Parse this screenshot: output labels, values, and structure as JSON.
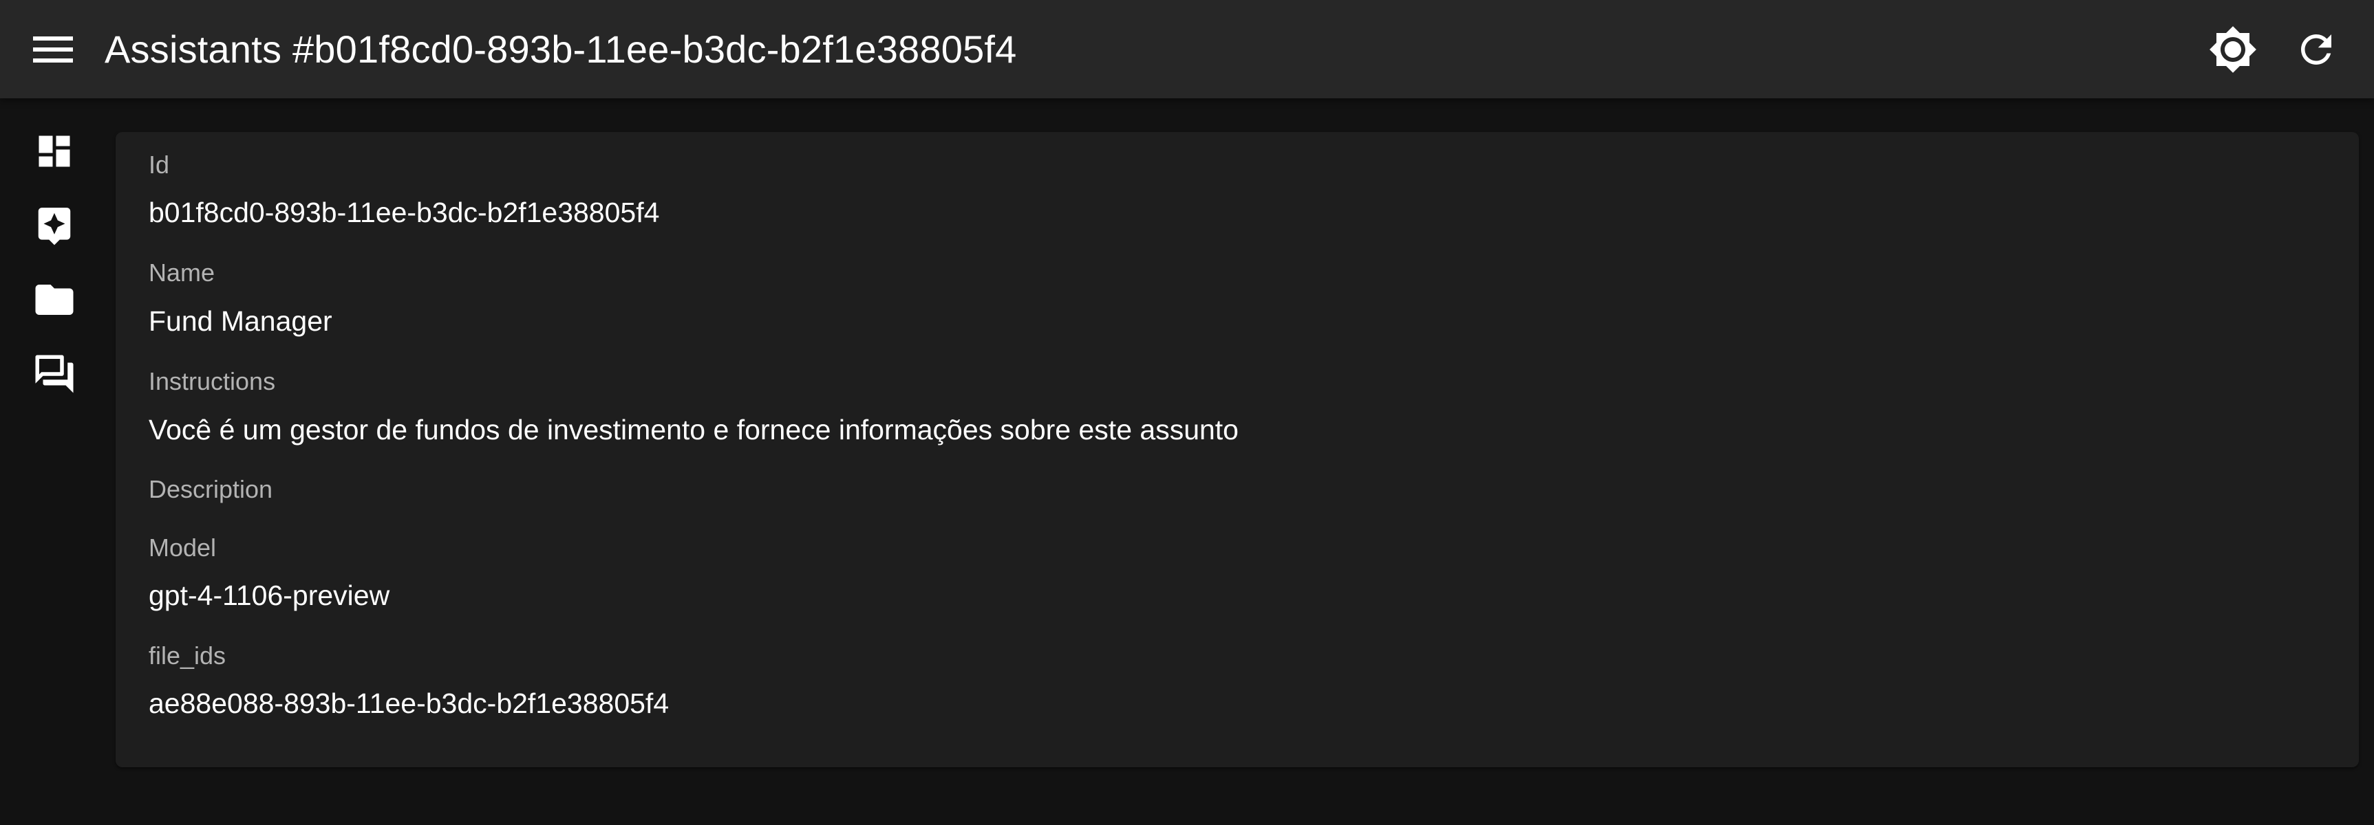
{
  "header": {
    "title": "Assistants #b01f8cd0-893b-11ee-b3dc-b2f1e38805f4",
    "menu_icon": "menu-icon",
    "theme_icon": "brightness-icon",
    "refresh_icon": "refresh-icon"
  },
  "sidebar": {
    "items": [
      {
        "icon": "dashboard-icon"
      },
      {
        "icon": "assistant-icon"
      },
      {
        "icon": "folder-icon"
      },
      {
        "icon": "forum-icon"
      }
    ]
  },
  "record": {
    "id_label": "Id",
    "id_value": "b01f8cd0-893b-11ee-b3dc-b2f1e38805f4",
    "name_label": "Name",
    "name_value": "Fund Manager",
    "instructions_label": "Instructions",
    "instructions_value": "Você é um gestor de fundos de investimento e fornece informações sobre este assunto",
    "description_label": "Description",
    "description_value": "",
    "model_label": "Model",
    "model_value": "gpt-4-1106-preview",
    "file_ids_label": "file_ids",
    "file_ids_value": "ae88e088-893b-11ee-b3dc-b2f1e38805f4"
  },
  "colors": {
    "appbar_bg": "#272727",
    "page_bg": "#121212",
    "card_bg": "#1e1e1e",
    "label_text": "#b3b3b3",
    "value_text": "#ffffff"
  }
}
